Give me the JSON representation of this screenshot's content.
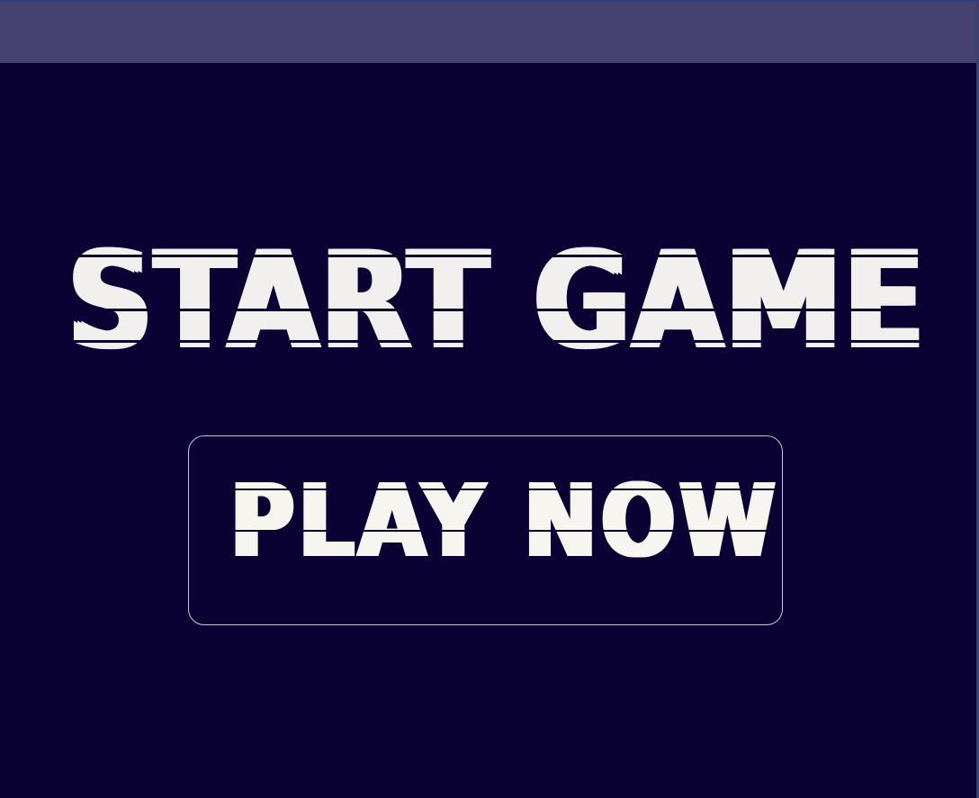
{
  "title": "START GAME",
  "button": {
    "label": "PLAY NOW"
  },
  "colors": {
    "background": "#0a0233",
    "top_bar": "#46426f",
    "text": "#f2f0ef",
    "button_border": "#c9c6d6"
  }
}
